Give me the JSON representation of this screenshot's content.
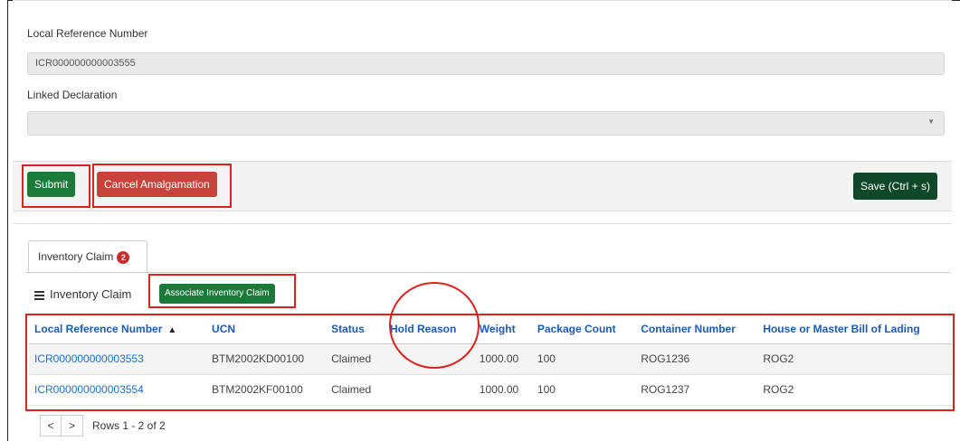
{
  "form": {
    "lrn_label": "Local Reference Number",
    "lrn_value": "ICR000000000003555",
    "linked_label": "Linked Declaration",
    "linked_value": ""
  },
  "actions": {
    "submit": "Submit",
    "cancel": "Cancel Amalgamation",
    "save": "Save (Ctrl + s)"
  },
  "tab": {
    "label": "Inventory Claim",
    "badge": "2"
  },
  "section": {
    "title": "Inventory Claim",
    "associate": "Associate Inventory Claim"
  },
  "table": {
    "headers": [
      "Local Reference Number",
      "UCN",
      "Status",
      "Hold Reason",
      "Weight",
      "Package Count",
      "Container Number",
      "House or Master Bill of Lading"
    ],
    "rows": [
      [
        "ICR000000000003553",
        "BTM2002KD00100",
        "Claimed",
        "",
        "1000.00",
        "100",
        "ROG1236",
        "ROG2"
      ],
      [
        "ICR000000000003554",
        "BTM2002KF00100",
        "Claimed",
        "",
        "1000.00",
        "100",
        "ROG1237",
        "ROG2"
      ]
    ]
  },
  "pager": {
    "prev": "<",
    "next": ">",
    "text": "Rows 1 - 2 of 2"
  },
  "colors": {
    "primary_green": "#1a7a3a",
    "danger_red": "#c8423a",
    "dark_green": "#10482a",
    "link_blue": "#1a6fc9",
    "annotation_red": "#e0201b"
  },
  "icons": {
    "menu": "hamburger-icon",
    "sort": "sort-ascending-icon",
    "dropdown": "chevron-down-icon"
  }
}
